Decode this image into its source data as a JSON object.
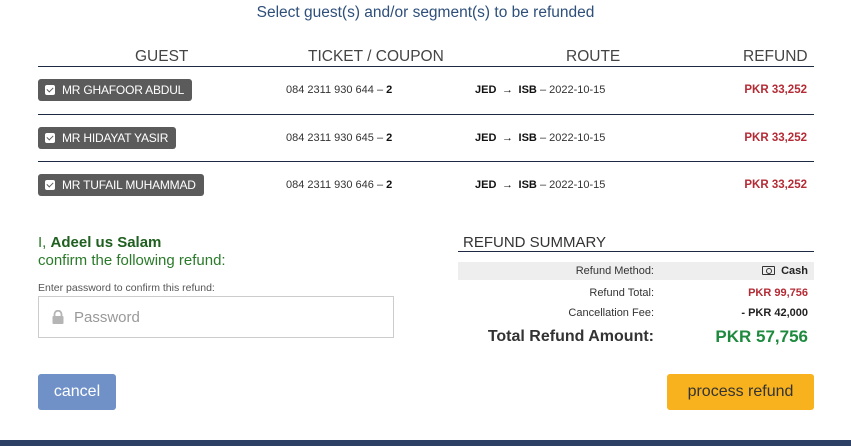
{
  "header": {
    "title": "Select guest(s) and/or segment(s) to be refunded"
  },
  "columns": {
    "guest": "GUEST",
    "ticket": "TICKET / COUPON",
    "route": "ROUTE",
    "refund": "REFUND"
  },
  "rows": [
    {
      "guest": "MR GHAFOOR ABDUL",
      "checked": true,
      "ticket": "084 2311 930 644 –",
      "coupon": "2",
      "from": "JED",
      "arrow": "→",
      "to": "ISB",
      "date": "– 2022-10-15",
      "refund": "PKR  33,252"
    },
    {
      "guest": "MR HIDAYAT YASIR",
      "checked": true,
      "ticket": "084 2311 930 645 –",
      "coupon": "2",
      "from": "JED",
      "arrow": "→",
      "to": "ISB",
      "date": "– 2022-10-15",
      "refund": "PKR  33,252"
    },
    {
      "guest": "MR TUFAIL MUHAMMAD",
      "checked": true,
      "ticket": "084 2311 930 646 –",
      "coupon": "2",
      "from": "JED",
      "arrow": "→",
      "to": "ISB",
      "date": "– 2022-10-15",
      "refund": "PKR  33,252"
    }
  ],
  "confirm": {
    "prefix": "I,",
    "name": "Adeel us Salam",
    "line2": "confirm the following refund:",
    "password_label": "Enter password to confirm this refund:",
    "password_placeholder": "Password"
  },
  "summary": {
    "title": "REFUND SUMMARY",
    "method_label": "Refund Method:",
    "method_value": "Cash",
    "total_label": "Refund Total:",
    "total_value": "PKR 99,756",
    "fee_label": "Cancellation Fee:",
    "fee_value": "- PKR 42,000",
    "grand_label": "Total Refund Amount:",
    "grand_value": "PKR 57,756"
  },
  "actions": {
    "cancel": "cancel",
    "process": "process refund"
  },
  "colors": {
    "accent_blue": "#6f91c8",
    "accent_orange": "#f7b21e",
    "refund_red": "#b52b35",
    "total_green": "#1e8a3e"
  },
  "icons": {
    "checkbox": "checkbox-checked-icon",
    "lock": "lock-icon",
    "cash": "cash-icon",
    "arrow": "arrow-right-icon"
  }
}
